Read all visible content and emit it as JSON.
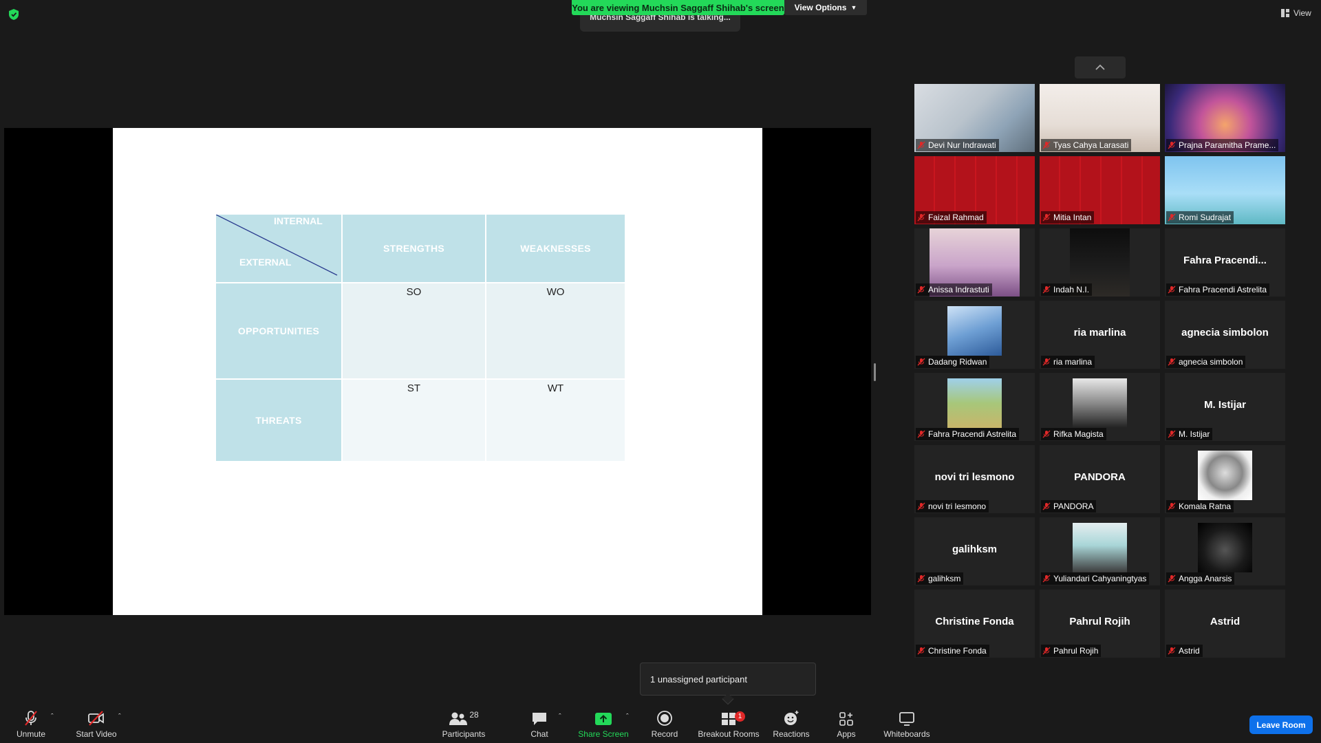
{
  "top": {
    "banner": "You are viewing Muchsin Saggaff Shihab's screen",
    "view_options": "View Options",
    "talking": "Muchsin Saggaff Shihab is talking...",
    "view_label": "View"
  },
  "slide": {
    "internal": "INTERNAL",
    "external": "EXTERNAL",
    "strengths": "STRENGTHS",
    "weaknesses": "WEAKNESSES",
    "opportunities": "OPPORTUNITIES",
    "threats": "THREATS",
    "so": "SO",
    "wo": "WO",
    "st": "ST",
    "wt": "WT"
  },
  "participants": [
    {
      "name": "Devi Nur Indrawati",
      "display": "",
      "video": "room"
    },
    {
      "name": "Tyas Cahya Larasati",
      "display": "",
      "video": "room-light"
    },
    {
      "name": "Prajna Paramitha Prame...",
      "display": "",
      "video": "purple"
    },
    {
      "name": "Faizal Rahmad",
      "display": "",
      "video": "red"
    },
    {
      "name": "Mitia Intan",
      "display": "",
      "video": "red"
    },
    {
      "name": "Romi Sudrajat",
      "display": "",
      "video": "beach"
    },
    {
      "name": "Anissa Indrastuti",
      "display": "",
      "video": "pink"
    },
    {
      "name": "Indah N.I.",
      "display": "",
      "video": "dark"
    },
    {
      "name": "Fahra Pracendi Astrelita",
      "display": "Fahra  Pracendi...",
      "video": ""
    },
    {
      "name": "Dadang Ridwan",
      "display": "",
      "video": "building"
    },
    {
      "name": "ria marlina",
      "display": "ria marlina",
      "video": ""
    },
    {
      "name": "agnecia simbolon",
      "display": "agnecia simbolon",
      "video": ""
    },
    {
      "name": "Fahra Pracendi Astrelita",
      "display": "",
      "video": "outdoor"
    },
    {
      "name": "Rifka Magista",
      "display": "",
      "video": "bw"
    },
    {
      "name": "M. Istijar",
      "display": "M. Istijar",
      "video": ""
    },
    {
      "name": "novi tri lesmono",
      "display": "novi tri lesmono",
      "video": ""
    },
    {
      "name": "PANDORA",
      "display": "PANDORA",
      "video": ""
    },
    {
      "name": "Komala Ratna",
      "display": "",
      "video": "hijab-bw"
    },
    {
      "name": "galihksm",
      "display": "galihksm",
      "video": ""
    },
    {
      "name": "Yuliandari Cahyaningtyas",
      "display": "",
      "video": "hijab"
    },
    {
      "name": "Angga Anarsis",
      "display": "",
      "video": "dark2"
    },
    {
      "name": "Christine Fonda",
      "display": "Christine Fonda",
      "video": ""
    },
    {
      "name": "Pahrul Rojih",
      "display": "Pahrul Rojih",
      "video": ""
    },
    {
      "name": "Astrid",
      "display": "Astrid",
      "video": ""
    }
  ],
  "popover": "1 unassigned participant",
  "toolbar": {
    "unmute": "Unmute",
    "start_video": "Start Video",
    "participants": "Participants",
    "participants_count": "28",
    "chat": "Chat",
    "share_screen": "Share Screen",
    "record": "Record",
    "breakout_rooms": "Breakout Rooms",
    "breakout_badge": "1",
    "reactions": "Reactions",
    "apps": "Apps",
    "whiteboards": "Whiteboards",
    "leave_room": "Leave Room"
  },
  "colors": {
    "banner_green": "#23d959",
    "swot_header": "#bfe1e8",
    "leave_blue": "#0e71eb",
    "muted_red": "#e02828"
  }
}
